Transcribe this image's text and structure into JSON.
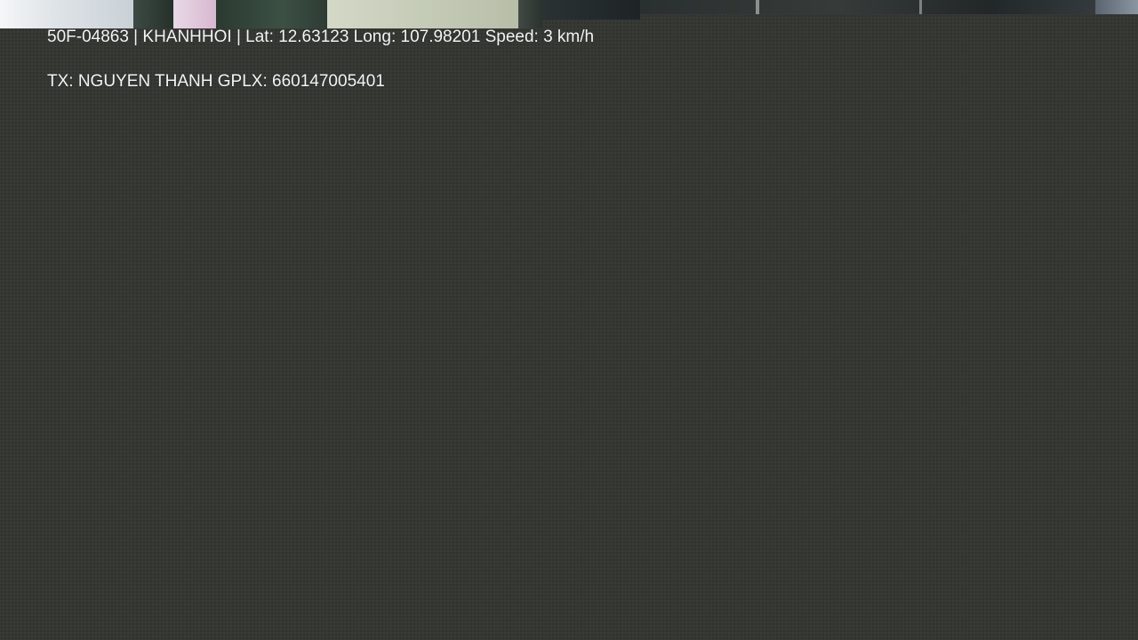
{
  "overlay": {
    "line1": "50F-04863 | KHANHHOI | Lat: 12.63123 Long: 107.98201 Speed: 3 km/h",
    "line2": "TX: NGUYEN THANH GPLX: 660147005401"
  },
  "colors": {
    "background": "#373935",
    "text": "#f4f4f4"
  }
}
